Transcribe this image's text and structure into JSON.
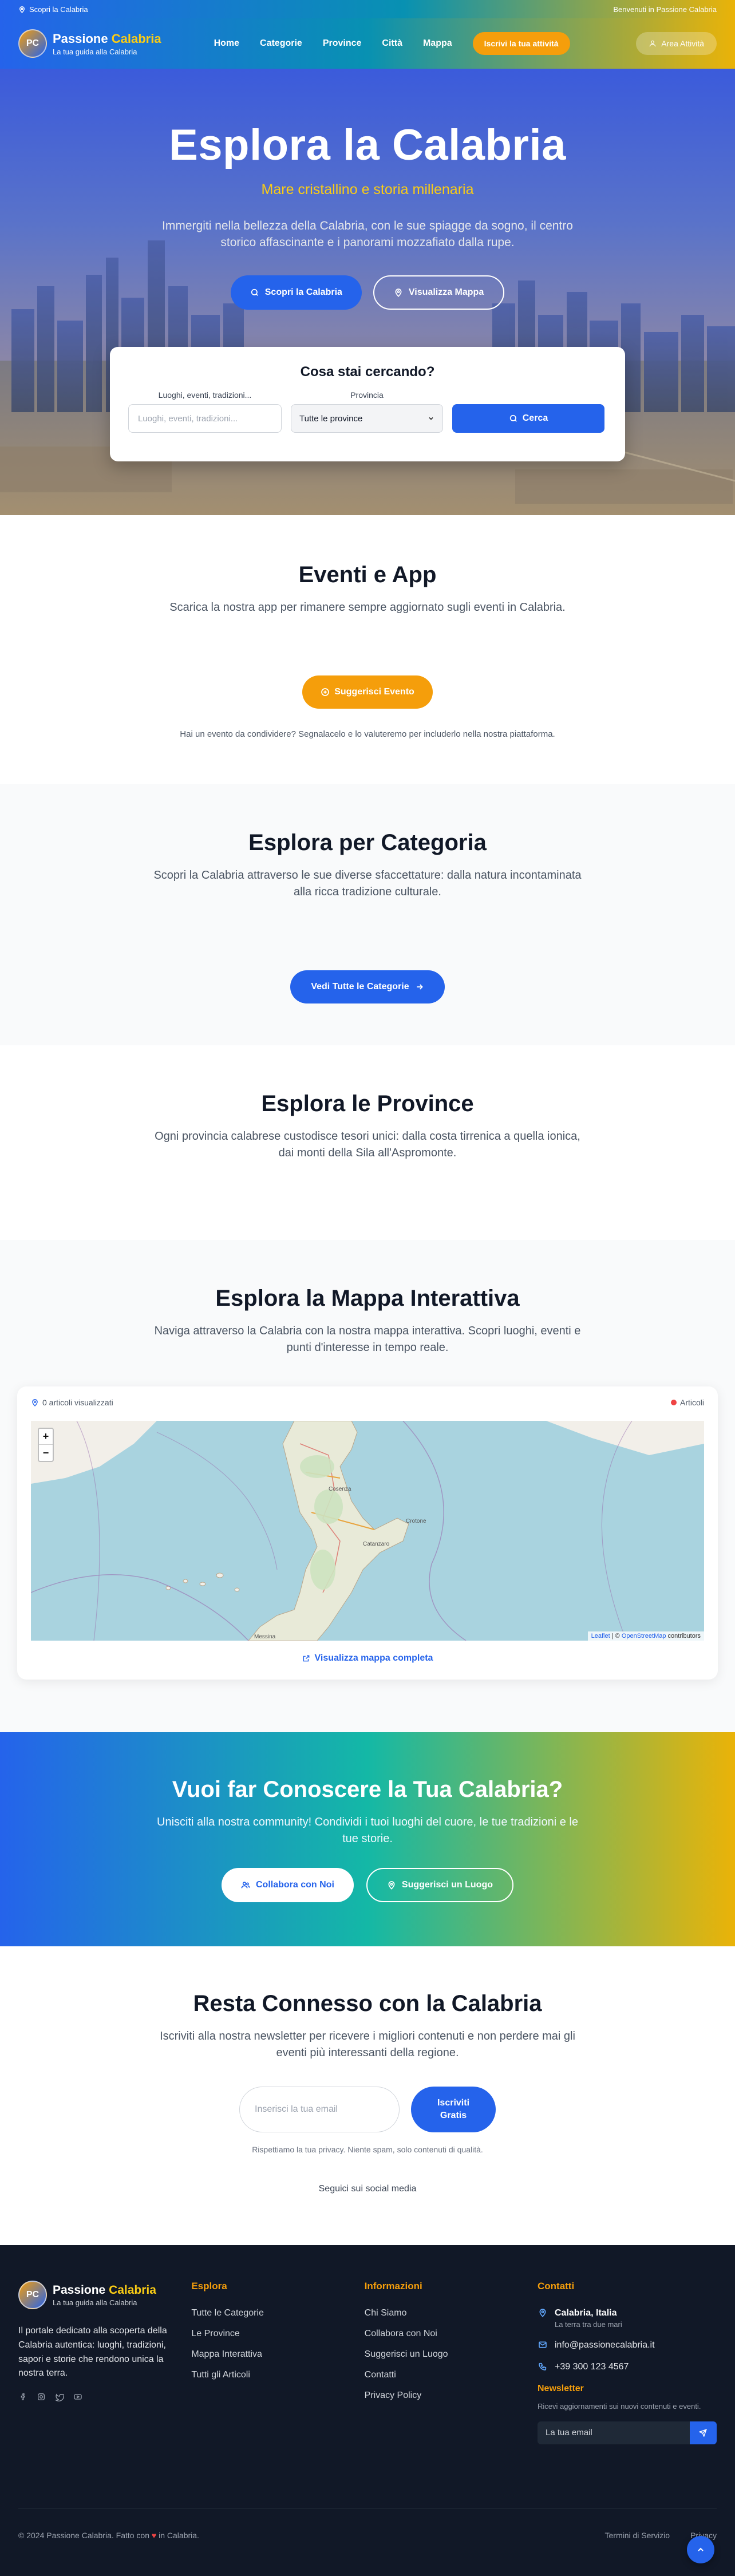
{
  "topbar": {
    "left_text": "Scopri la Calabria",
    "right_text": "Benvenuti in Passione Calabria"
  },
  "header": {
    "logo_initials": "PC",
    "brand_main": "Passione",
    "brand_accent": "Calabria",
    "brand_sub": "La tua guida alla Calabria",
    "nav": [
      "Home",
      "Categorie",
      "Province",
      "Città",
      "Mappa"
    ],
    "register_label": "Iscrivi la tua attività",
    "area_label": "Area Attività"
  },
  "hero": {
    "title": "Esplora la Calabria",
    "tagline": "Mare cristallino e storia millenaria",
    "description": "Immergiti nella bellezza della Calabria, con le sue spiagge da sogno, il centro storico affascinante e i panorami mozzafiato dalla rupe.",
    "btn_discover": "Scopri la Calabria",
    "btn_map": "Visualizza Mappa"
  },
  "search": {
    "title": "Cosa stai cercando?",
    "query_label": "Luoghi, eventi, tradizioni...",
    "query_placeholder": "Luoghi, eventi, tradizioni...",
    "province_label": "Provincia",
    "province_selected": "Tutte le province",
    "button": "Cerca"
  },
  "events": {
    "title": "Eventi e App",
    "subtitle": "Scarica la nostra app per rimanere sempre aggiornato sugli eventi in Calabria.",
    "button": "Suggerisci Evento",
    "note": "Hai un evento da condividere? Segnalacelo e lo valuteremo per includerlo nella nostra piattaforma."
  },
  "categories": {
    "title": "Esplora per Categoria",
    "subtitle": "Scopri la Calabria attraverso le sue diverse sfaccettature: dalla natura incontaminata alla ricca tradizione culturale.",
    "button": "Vedi Tutte le Categorie"
  },
  "provinces": {
    "title": "Esplora le Province",
    "subtitle": "Ogni provincia calabrese custodisce tesori unici: dalla costa tirrenica a quella ionica, dai monti della Sila all'Aspromonte."
  },
  "map": {
    "title": "Esplora la Mappa Interattiva",
    "subtitle": "Naviga attraverso la Calabria con la nostra mappa interattiva. Scopri luoghi, eventi e punti d'interesse in tempo reale.",
    "count_text": "0 articoli visualizzati",
    "legend": "Articoli",
    "zoom_in": "+",
    "zoom_out": "−",
    "attribution_leaflet": "Leaflet",
    "attribution_sep": " | © ",
    "attribution_osm": "OpenStreetMap",
    "attribution_suffix": " contributors",
    "full_link": "Visualizza mappa completa",
    "city_labels": [
      "Cosenza",
      "Crotone",
      "Catanzaro",
      "Messina"
    ]
  },
  "cta": {
    "title": "Vuoi far Conoscere la Tua Calabria?",
    "subtitle": "Unisciti alla nostra community! Condividi i tuoi luoghi del cuore, le tue tradizioni e le tue storie.",
    "btn_collab": "Collabora con Noi",
    "btn_suggest": "Suggerisci un Luogo"
  },
  "newsletter": {
    "title": "Resta Connesso con la Calabria",
    "subtitle": "Iscriviti alla nostra newsletter per ricevere i migliori contenuti e non perdere mai gli eventi più interessanti della regione.",
    "placeholder": "Inserisci la tua email",
    "button_line1": "Iscriviti",
    "button_line2": "Gratis",
    "privacy": "Rispettiamo la tua privacy. Niente spam, solo contenuti di qualità.",
    "social_label": "Seguici sui social media"
  },
  "footer": {
    "description": "Il portale dedicato alla scoperta della Calabria autentica: luoghi, tradizioni, sapori e storie che rendono unica la nostra terra.",
    "explore_title": "Esplora",
    "explore_links": [
      "Tutte le Categorie",
      "Le Province",
      "Mappa Interattiva",
      "Tutti gli Articoli"
    ],
    "info_title": "Informazioni",
    "info_links": [
      "Chi Siamo",
      "Collabora con Noi",
      "Suggerisci un Luogo",
      "Contatti",
      "Privacy Policy"
    ],
    "contacts_title": "Contatti",
    "location": "Calabria, Italia",
    "location_sub": "La terra tra due mari",
    "email": "info@passionecalabria.it",
    "phone": "+39 300 123 4567",
    "newsletter_title": "Newsletter",
    "newsletter_text": "Ricevi aggiornamenti sui nuovi contenuti e eventi.",
    "newsletter_placeholder": "La tua email",
    "copyright_pre": "© 2024 Passione Calabria. Fatto con",
    "copyright_post": "in Calabria.",
    "terms": "Termini di Servizio",
    "privacy": "Privacy"
  },
  "colors": {
    "primary": "#2563eb",
    "accent": "#f59e0b",
    "footer_bg": "#111827"
  }
}
